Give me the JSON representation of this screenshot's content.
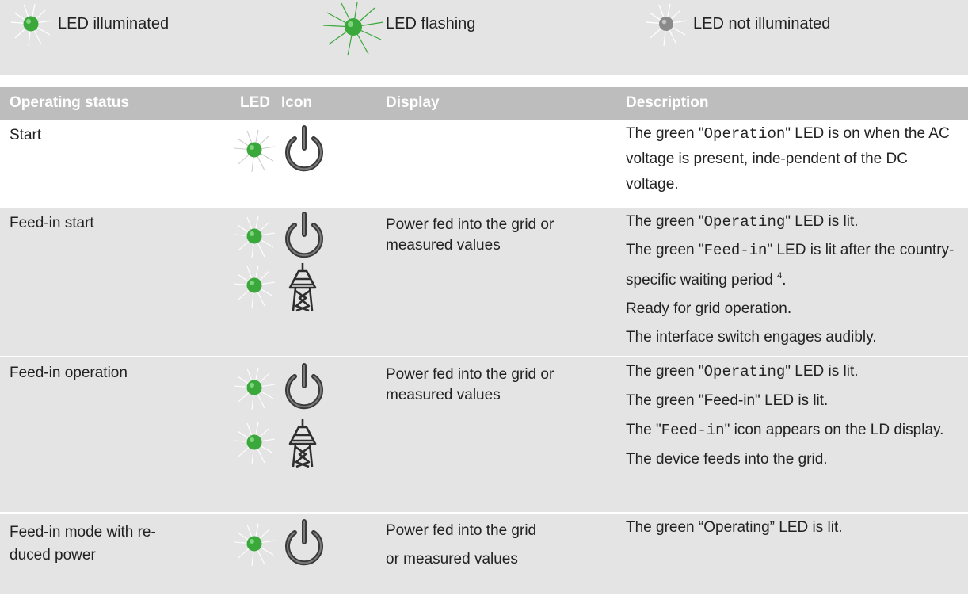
{
  "legend": {
    "illuminated": "LED illuminated",
    "flashing": "LED flashing",
    "not_illuminated": "LED not illuminated"
  },
  "colors": {
    "led_green": "#3aa83a",
    "led_grey": "#8a8a8a",
    "header_bg": "#bdbdbd",
    "row_bg": "#e4e4e4"
  },
  "table": {
    "headers": {
      "status": "Operating status",
      "led": "LED",
      "icon": "Icon",
      "display": "Display",
      "description": "Description"
    },
    "rows": [
      {
        "status": "Start",
        "display": "",
        "icons": [
          "power-icon"
        ],
        "desc": {
          "p1_pre": "The green \"",
          "p1_mono": "Operation",
          "p1_post": "\" LED is on when the AC voltage is present, inde-pendent of the DC voltage."
        }
      },
      {
        "status": "Feed-in start",
        "display": "Power fed into the grid or measured values",
        "icons": [
          "power-icon",
          "grid-pylon-icon"
        ],
        "desc": {
          "p1_pre": "The green \"",
          "p1_mono": "Operating",
          "p1_post": "\" LED is lit.",
          "p2_pre": "The green \"",
          "p2_mono": "Feed-in",
          "p2_post": "\" LED is lit after the country-specific waiting period",
          "p2_sup": "4",
          "p2_end": ".",
          "p3": "Ready for grid operation.",
          "p4": "The interface switch engages audibly."
        }
      },
      {
        "status": "Feed-in operation",
        "display": "Power fed into the grid or measured values",
        "icons": [
          "power-icon",
          "grid-pylon-icon"
        ],
        "desc": {
          "p1_pre": "The green \"",
          "p1_mono": "Operating",
          "p1_post": "\" LED is lit.",
          "p2": "The green \"Feed-in\" LED is lit.",
          "p3_pre": "The \"",
          "p3_mono": "Feed-in",
          "p3_post": "\" icon appears on the LD display.",
          "p4": "The device feeds into the grid."
        }
      },
      {
        "status": "Feed-in mode with re-duced power",
        "display_l1": "Power fed into the grid",
        "display_l2": "or measured values",
        "icons": [
          "power-icon"
        ],
        "desc": {
          "p1": "The green “Operating” LED is lit."
        }
      }
    ]
  }
}
